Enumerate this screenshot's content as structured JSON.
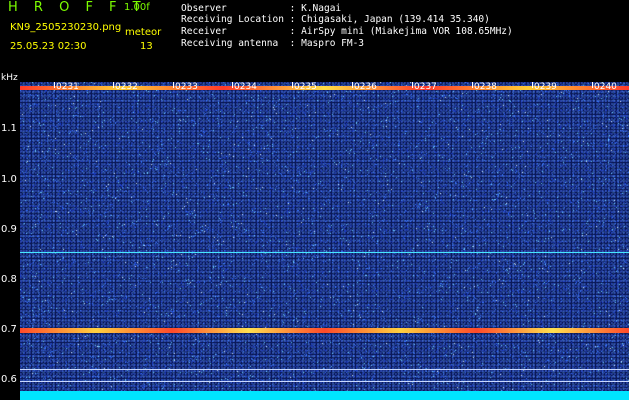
{
  "header": {
    "app_title": "H R O F F T",
    "version": "1.00f",
    "filename": "KN9_2505230230.png",
    "datetime": "25.05.23 02:30",
    "meteor_label": "meteor",
    "meteor_count": "13"
  },
  "info": {
    "observer": "Observer           : K.Nagai",
    "location": "Receiving Location : Chigasaki, Japan (139.414 35.340)",
    "receiver": "Receiver           : AirSpy mini (Miakejima VOR 108.65MHz)",
    "antenna": "Receiving antenna  : Maspro FM-3"
  },
  "spectrogram": {
    "unit_label": "kHz",
    "y_ticks": [
      "1.1",
      "1.0",
      "0.9",
      "0.8",
      "0.7",
      "0.6"
    ],
    "time_labels": [
      "0231",
      "0232",
      "0233",
      "0234",
      "0235",
      "0236",
      "0237",
      "0238",
      "0239",
      "0240"
    ],
    "colors": {
      "background": "#0a1a5a",
      "signal": "#ff3030",
      "baseline": "#00e5ff",
      "axis_text": "#ffffff",
      "title_green": "#7CFC00",
      "meta_yellow": "#ffff00"
    }
  }
}
